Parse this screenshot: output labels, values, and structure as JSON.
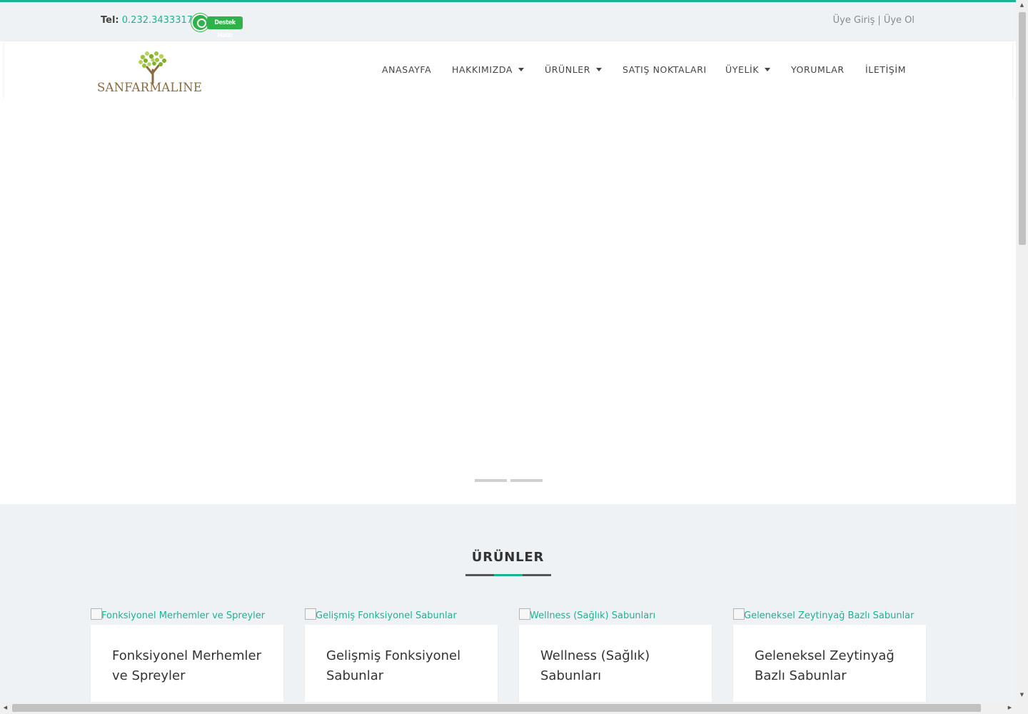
{
  "topbar": {
    "tel_label": "Tel:",
    "tel_number": "0.232.3433317",
    "whatsapp_badge": "Destek Hattı",
    "login": "Üye Giriş",
    "separator": "|",
    "register": "Üye Ol"
  },
  "logo": {
    "text": "SANFARMALINE"
  },
  "nav": {
    "items": [
      {
        "label": "ANASAYFA"
      },
      {
        "label": "HAKKIMIZDA"
      },
      {
        "label": "ÜRÜNLER"
      },
      {
        "label": "SATIŞ NOKTALARI"
      },
      {
        "label": "ÜYELİK"
      },
      {
        "label": "YORUMLAR"
      },
      {
        "label": "İLETİŞİM"
      }
    ]
  },
  "products": {
    "title": "ÜRÜNLER",
    "items": [
      {
        "img_alt": "Fonksiyonel Merhemler ve Spreyler",
        "title": "Fonksiyonel Merhemler ve Spreyler"
      },
      {
        "img_alt": "Gelişmiş Fonksiyonel Sabunlar",
        "title": "Gelişmiş Fonksiyonel Sabunlar"
      },
      {
        "img_alt": "Wellness (Sağlık) Sabunları",
        "title": "Wellness (Sağlık) Sabunları"
      },
      {
        "img_alt": "Geleneksel Zeytinyağ Bazlı Sabunlar",
        "title": "Geleneksel Zeytinyağ Bazlı Sabunlar"
      }
    ]
  },
  "colors": {
    "accent": "#1ab394",
    "logo_brown": "#8a6a3e",
    "whatsapp": "#2fb24a",
    "section_bg": "#eff2f4"
  },
  "icons": {
    "whatsapp": "whatsapp-icon",
    "caret": "caret-down-icon",
    "logo": "tree-logo-icon"
  }
}
